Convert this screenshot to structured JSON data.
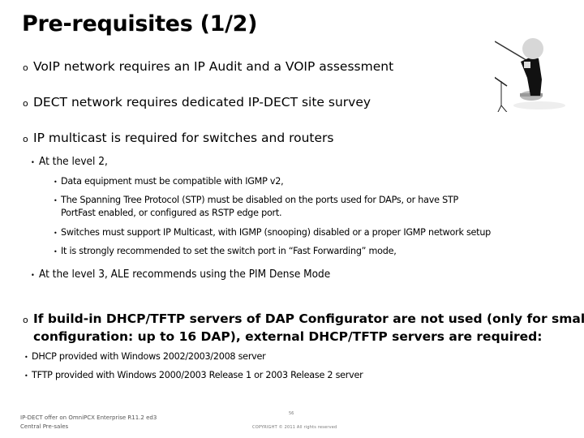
{
  "slide": {
    "title": "Pre-requisites (1/2)",
    "bullet_l1": "o",
    "bullet_sub": "•",
    "items": {
      "voip": "VoIP network requires an IP Audit and a VOIP assessment",
      "dect": "DECT network requires dedicated IP-DECT site survey",
      "multicast": "IP multicast is required for switches and routers",
      "level2": "At the level 2,",
      "level2_items": [
        "Data equipment must be compatible with IGMP v2,",
        "The Spanning Tree Protocol (STP) must be disabled on the ports used for DAPs, or have STP",
        "PortFast enabled, or configured as RSTP edge port.",
        "Switches must support IP Multicast, with IGMP (snooping) disabled or a proper IGMP network setup",
        "It is strongly recommended to set the switch port in “Fast Forwarding” mode,"
      ],
      "level3": "At the level 3, ALE recommends using the PIM Dense Mode",
      "dhcp_line1": "If build-in DHCP/TFTP servers of DAP Configurator are not used (only for small",
      "dhcp_line2": "configuration: up to 16 DAP),  external DHCP/TFTP servers are required:",
      "dhcp_items": [
        "DHCP provided with Windows 2002/2003/2008 server",
        "TFTP provided with Windows 2000/2003 Release 1 or 2003 Release 2 server"
      ]
    }
  },
  "figure": {
    "icon": "conductor-figure-icon"
  },
  "footer": {
    "line1": "IP-DECT offer on OmniPCX Enterprise R11.2 ed3",
    "line2": "Central Pre-sales",
    "page": "56",
    "copyright": "COPYRIGHT © 2011 All rights reserved"
  }
}
